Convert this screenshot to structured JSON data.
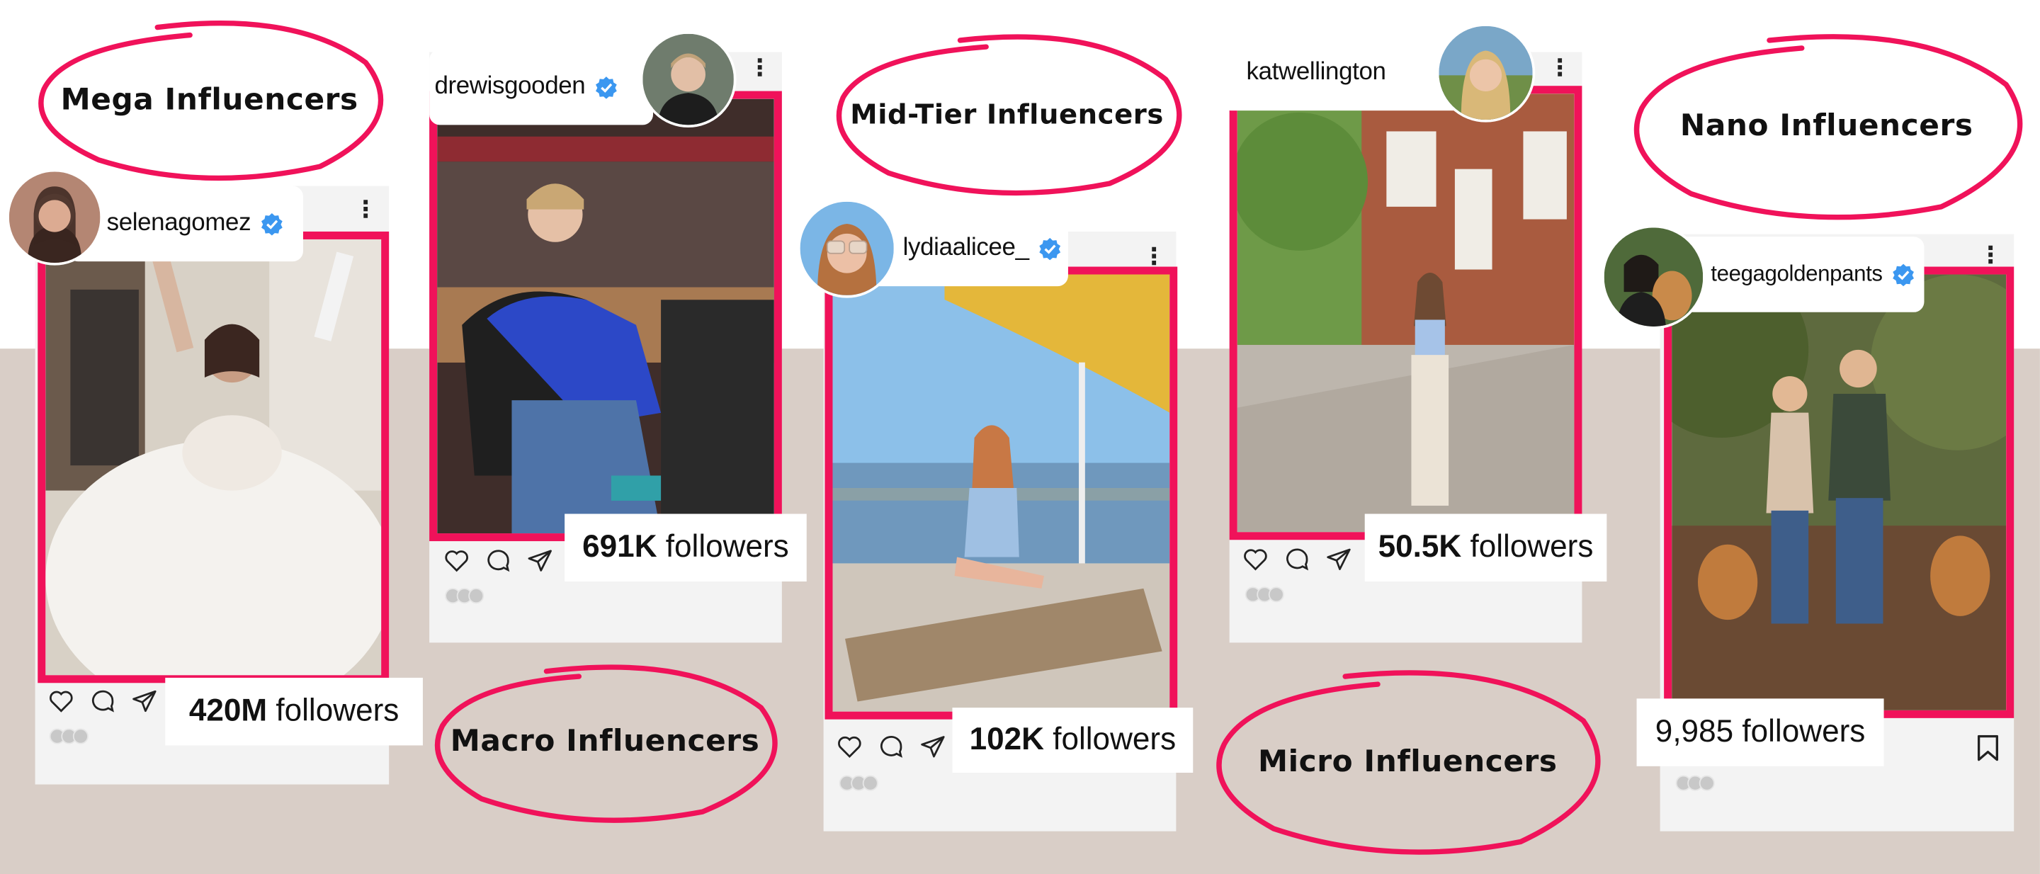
{
  "colors": {
    "accent": "#f0125a",
    "background_band": "#d9cec7",
    "verified": "#3b97f0"
  },
  "tiers": {
    "mega": "Mega Influencers",
    "macro": "Macro Influencers",
    "mid": "Mid-Tier Influencers",
    "micro": "Micro Influencers",
    "nano": "Nano Influencers"
  },
  "posts": [
    {
      "username": "selenagomez",
      "verified": true,
      "followers_number": "420M",
      "followers_word": "followers",
      "icons": [
        "heart-icon",
        "comment-icon",
        "share-icon",
        "more-icon"
      ]
    },
    {
      "username": "drewisgooden",
      "verified": true,
      "followers_number": "691K",
      "followers_word": "followers",
      "icons": [
        "heart-icon",
        "comment-icon",
        "share-icon",
        "more-icon"
      ]
    },
    {
      "username": "lydiaalicee_",
      "verified": true,
      "followers_number": "102K",
      "followers_word": "followers",
      "icons": [
        "heart-icon",
        "comment-icon",
        "share-icon",
        "more-icon"
      ]
    },
    {
      "username": "katwellington",
      "verified": false,
      "followers_number": "50.5K",
      "followers_word": "followers",
      "icons": [
        "heart-icon",
        "comment-icon",
        "share-icon",
        "more-icon"
      ]
    },
    {
      "username": "teegagoldenpants",
      "verified": true,
      "followers_number": "9,985",
      "followers_word": "followers",
      "icons": [
        "bookmark-icon",
        "more-icon"
      ]
    }
  ]
}
